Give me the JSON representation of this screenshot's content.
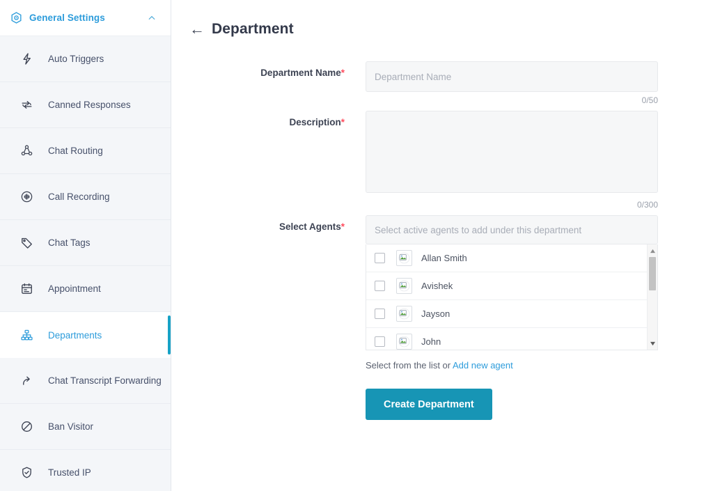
{
  "sidebar": {
    "header": {
      "title": "General Settings",
      "icon": "hexagon-target-icon",
      "chevron": "chevron-up-icon",
      "accent_color": "#2d9cdb"
    },
    "items": [
      {
        "label": "Auto Triggers",
        "icon": "lightning-bolt-icon",
        "active": false
      },
      {
        "label": "Canned Responses",
        "icon": "refresh-loop-icon",
        "active": false
      },
      {
        "label": "Chat Routing",
        "icon": "routing-nodes-icon",
        "active": false
      },
      {
        "label": "Call Recording",
        "icon": "audio-wave-circle-icon",
        "active": false
      },
      {
        "label": "Chat Tags",
        "icon": "tag-icon",
        "active": false
      },
      {
        "label": "Appointment",
        "icon": "calendar-icon",
        "active": false
      },
      {
        "label": "Departments",
        "icon": "org-chart-icon",
        "active": true
      },
      {
        "label": "Chat Transcript Forwarding",
        "icon": "forward-arrow-icon",
        "active": false
      },
      {
        "label": "Ban Visitor",
        "icon": "no-entry-icon",
        "active": false
      },
      {
        "label": "Trusted IP",
        "icon": "shield-check-icon",
        "active": false
      }
    ]
  },
  "main": {
    "back_arrow": "←",
    "page_title": "Department",
    "required_mark": "*",
    "fields": {
      "department_name": {
        "label": "Department Name",
        "placeholder": "Department Name",
        "value": "",
        "counter": "0/50"
      },
      "description": {
        "label": "Description",
        "placeholder": "",
        "value": "",
        "counter": "0/300"
      },
      "select_agents": {
        "label": "Select Agents",
        "placeholder": "Select active agents to add under this department",
        "agents": [
          {
            "name": "Allan Smith",
            "checked": false,
            "avatar": "broken-image-placeholder"
          },
          {
            "name": "Avishek",
            "checked": false,
            "avatar": "broken-image-placeholder"
          },
          {
            "name": "Jayson",
            "checked": false,
            "avatar": "broken-image-placeholder"
          },
          {
            "name": "John",
            "checked": false,
            "avatar": "broken-image-placeholder"
          }
        ],
        "scroll_up_icon": "triangle-up-icon",
        "scroll_down_icon": "triangle-down-icon"
      }
    },
    "helper_prefix": "Select from the list or ",
    "helper_link": "Add new agent",
    "submit_label": "Create Department",
    "submit_color": "#1795b5"
  }
}
